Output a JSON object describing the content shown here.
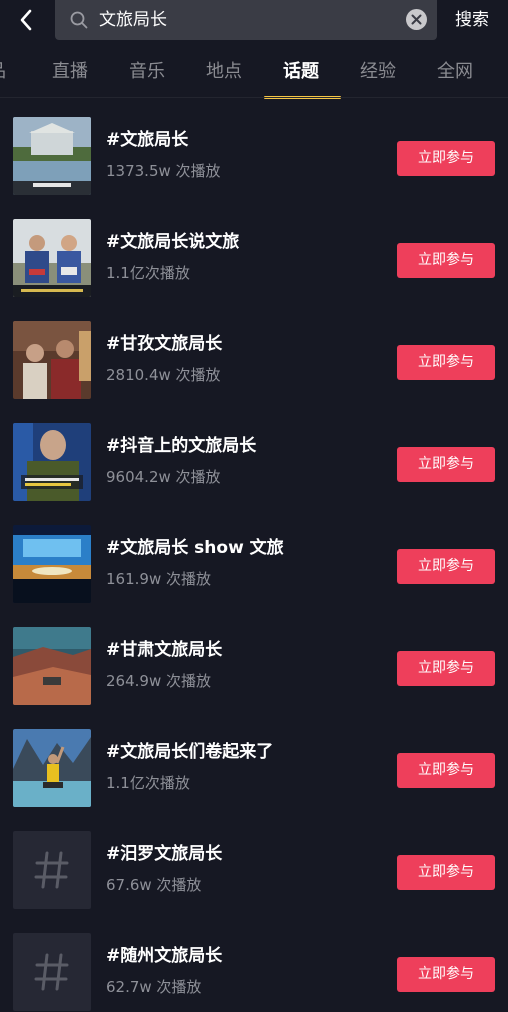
{
  "search": {
    "query": "文旅局长",
    "submit_label": "搜索"
  },
  "tabs": [
    {
      "label": "品"
    },
    {
      "label": "直播"
    },
    {
      "label": "音乐"
    },
    {
      "label": "地点"
    },
    {
      "label": "话题",
      "active": true
    },
    {
      "label": "经验"
    },
    {
      "label": "全网"
    }
  ],
  "colors": {
    "background": "#161823",
    "accent_tab": "#f4c545",
    "join_button": "#ee3f5b"
  },
  "topics": [
    {
      "title": "#文旅局长",
      "plays": "1373.5w 次播放",
      "button": "立即参与",
      "thumb": "photo-garden"
    },
    {
      "title": "#文旅局长说文旅",
      "plays": "1.1亿次播放",
      "button": "立即参与",
      "thumb": "photo-costume"
    },
    {
      "title": "#甘孜文旅局长",
      "plays": "2810.4w 次播放",
      "button": "立即参与",
      "thumb": "photo-indoor"
    },
    {
      "title": "#抖音上的文旅局长",
      "plays": "9604.2w 次播放",
      "button": "立即参与",
      "thumb": "photo-man"
    },
    {
      "title": "#文旅局长 show 文旅",
      "plays": "161.9w 次播放",
      "button": "立即参与",
      "thumb": "photo-stage"
    },
    {
      "title": "#甘肃文旅局长",
      "plays": "264.9w 次播放",
      "button": "立即参与",
      "thumb": "photo-desert"
    },
    {
      "title": "#文旅局长们卷起来了",
      "plays": "1.1亿次播放",
      "button": "立即参与",
      "thumb": "photo-lake"
    },
    {
      "title": "#汨罗文旅局长",
      "plays": "67.6w 次播放",
      "button": "立即参与",
      "thumb": "hash-icon"
    },
    {
      "title": "#随州文旅局长",
      "plays": "62.7w 次播放",
      "button": "立即参与",
      "thumb": "hash-icon"
    }
  ]
}
